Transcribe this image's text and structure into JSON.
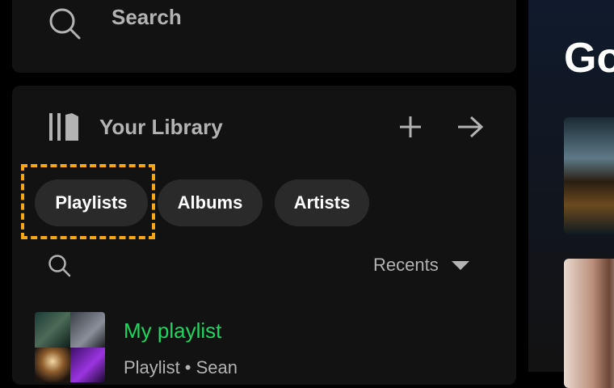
{
  "search": {
    "label": "Search",
    "icon": "search-icon"
  },
  "library": {
    "title": "Your Library",
    "icon": "library-icon",
    "create_icon": "plus-icon",
    "expand_icon": "arrow-right-icon",
    "filters": [
      "Playlists",
      "Albums",
      "Artists"
    ],
    "sort_label": "Recents",
    "items": [
      {
        "name": "My playlist",
        "subtitle": "Playlist • Sean"
      }
    ]
  },
  "main": {
    "heading": "Go"
  },
  "colors": {
    "accent_green": "#1ed760",
    "highlight_box": "#f7a614",
    "panel_bg": "#121212",
    "chip_bg": "#2a2a2a"
  }
}
